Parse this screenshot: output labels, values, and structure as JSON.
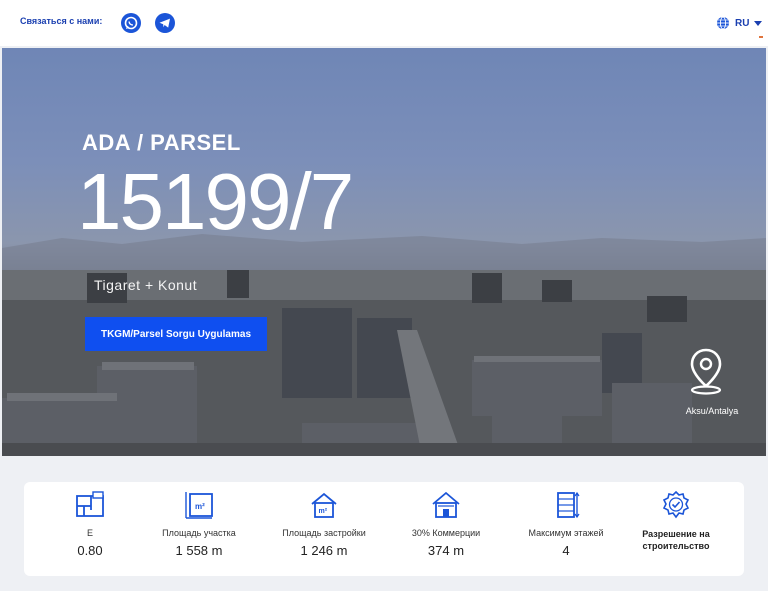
{
  "header": {
    "contact_label": "Связаться с нами:",
    "language": "RU"
  },
  "hero": {
    "eyebrow": "ADA / PARSEL",
    "parcel_number": "15199/7",
    "zoning": "Tigaret + Konut",
    "cta_label": "TKGM/Parsel Sorgu Uygulamas",
    "location": "Aksu/Antalya"
  },
  "stats": [
    {
      "label": "E",
      "value": "0.80"
    },
    {
      "label": "Площадь участка",
      "value": "1 558 m"
    },
    {
      "label": "Площадь застройки",
      "value": "1 246 m"
    },
    {
      "label": "30% Коммерции",
      "value": "374 m"
    },
    {
      "label": "Максимум этажей",
      "value": "4"
    },
    {
      "label": "Разрешение на строительство",
      "value": ""
    }
  ],
  "colors": {
    "accent": "#0f4ff0",
    "header_text": "#1a3fb0",
    "icon_blue": "#1b55d8"
  }
}
